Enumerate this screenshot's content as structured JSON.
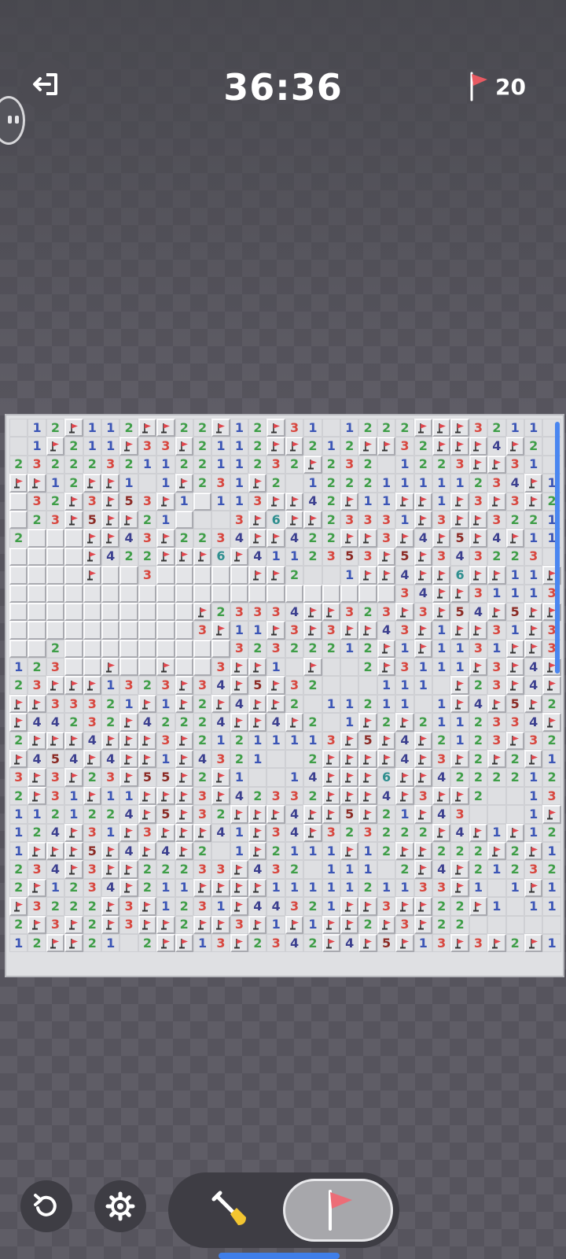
{
  "header": {
    "exit_icon": "exit-icon",
    "timer": "36:36",
    "flags_remaining": "20"
  },
  "board": {
    "columns": 30,
    "rows": 29,
    "legend": {
      ".": "open-empty",
      "#": "unopened",
      "F": "flag",
      "1-8": "number"
    },
    "grid": [
      ".12F112FF22F12F31.1222FFF3211.",
      ".1F211F33F2112FF212FF32FFF4F2.",
      "2322232112211232F232.1223FF31",
      "FF12FF1.1F231F2.122211111234F1",
      "#32F3F53F1#113FF42F11FF1F3F3F21",
      "#23F5FF21#..3F6FF23331F3FF3221",
      "2###FF43F2234FF422FF3F4F5F4F11F1",
      "####F422FFF6F4112353F5F343223",
      "####F##3#####FF2..1FF4FF6FF11FF",
      "#####################34FF31113335FFF4433F2",
      "##########F23334FF323F3F54F5FFF2.",
      "##########3F11F3F3FF43F1FF31F3F1",
      "##2#########32322212F1F1131FF35F4F1",
      "123##F##F##3FF1.F..2F3111F3F4F4F22",
      "23FFF1323F34F5F32...111.F23F4F1",
      "FF33321F1F2F4FF2.11211.1F4F5F2",
      "F44232F42224FF4F2.1F2F2112334F3F1",
      "2FFF4FFF3F21211113F5F4F2123F3211",
      "F454F4FF1F4321..2FFFF4F3F2F2F111",
      "3F3F23F55F2F1..14FFF6FF4222212F2",
      "2F31F11FFF3F42332FFF4F3FF2..13F2",
      "1121224F5F32FFF4FF5F21F43...1F21",
      "124F31F3FFF41F34F323222F4F1F1211.",
      "1FFF5F4F4F2.1F2111F12FF222F2F1.",
      "234F3FF22233F432.111.2F4F21232211",
      "2F1234F211FFFF1111121133F1.1F111F2",
      "F3222F3F1231F44321FF3FF22F1.1112F35F",
      "2F3F2F3FF2FF3F1F1FF2F3F22.....1FF1F",
      "12FF21.2FF13F2342F4F5F13F3F2F11.123"
    ]
  },
  "controls": {
    "undo_icon": "undo-icon",
    "settings_icon": "gear-icon",
    "dig_mode_icon": "shovel-icon",
    "flag_mode_icon": "flag-icon",
    "active_mode": "flag"
  },
  "colors": {
    "n1": "#3b55b6",
    "n2": "#3f9e48",
    "n3": "#d8473f",
    "n4": "#3b3f8f",
    "n5": "#8b2a24",
    "n6": "#2f8f8f",
    "flag_red": "#e0454c",
    "accent_blue": "#3f7ee8"
  }
}
